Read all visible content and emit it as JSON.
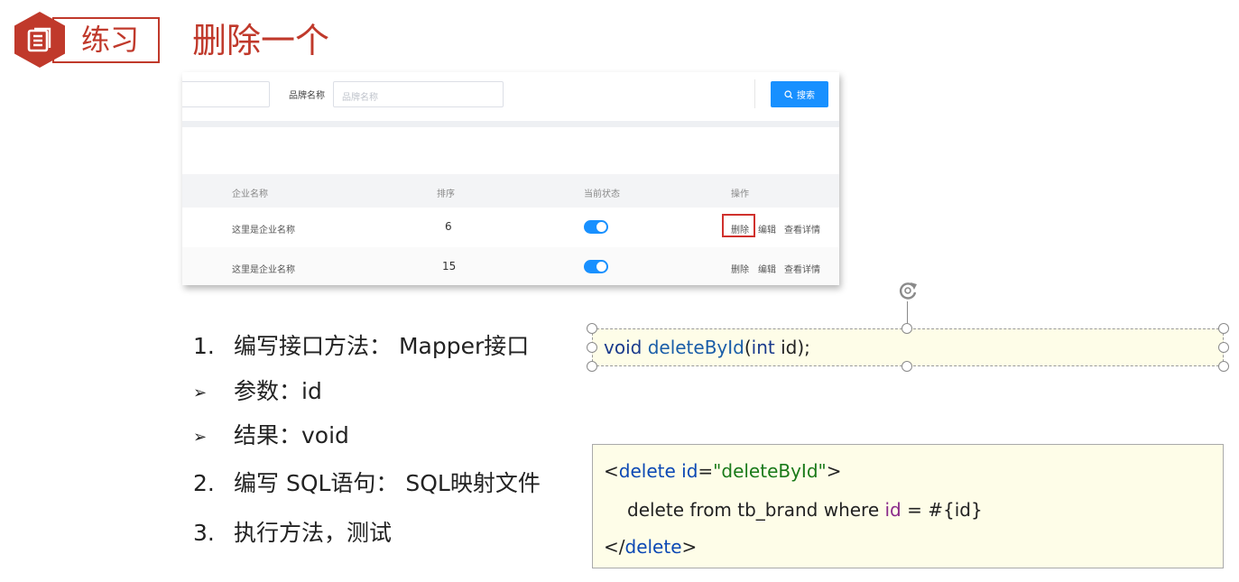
{
  "slide": {
    "tag_label": "练习",
    "title": "删除一个"
  },
  "screenshot": {
    "brand_label": "品牌名称",
    "brand_placeholder": "品牌名称",
    "search_button": "搜索",
    "columns": [
      "企业名称",
      "排序",
      "当前状态",
      "操作"
    ],
    "rows": [
      {
        "company": "这里是企业名称",
        "order": "6",
        "status_on": true,
        "ops": [
          "删除",
          "编辑",
          "查看详情"
        ],
        "highlight_delete": true
      },
      {
        "company": "这里是企业名称",
        "order": "15",
        "status_on": true,
        "ops": [
          "删除",
          "编辑",
          "查看详情"
        ],
        "highlight_delete": false
      }
    ],
    "colors": {
      "primary": "#1890ff",
      "highlight": "#d0312d"
    }
  },
  "steps": [
    {
      "num": "1.",
      "text": "编写接口方法： Mapper接口"
    },
    {
      "num": "➢",
      "text": "参数：id"
    },
    {
      "num": "➢",
      "text": "结果：void"
    },
    {
      "num": "2.",
      "text": "编写 SQL语句： SQL映射文件"
    },
    {
      "num": "3.",
      "text": "执行方法，测试"
    }
  ],
  "code_interface": {
    "void": "void",
    "method": "deleteById",
    "open": "(",
    "int": "int",
    "param": "id",
    "close": ");"
  },
  "code_xml": {
    "open_bracket": "<",
    "tag": "delete",
    "attr": "id",
    "eq": "=",
    "attr_value": "\"deleteById\"",
    "gt": ">",
    "statement": "delete from tb_brand where",
    "kw_id": "id",
    "rest": "= #{id}",
    "close_open": "</",
    "close_gt": ">"
  },
  "colors": {
    "accent": "#c0392b",
    "code_bg": "#fefde8"
  }
}
